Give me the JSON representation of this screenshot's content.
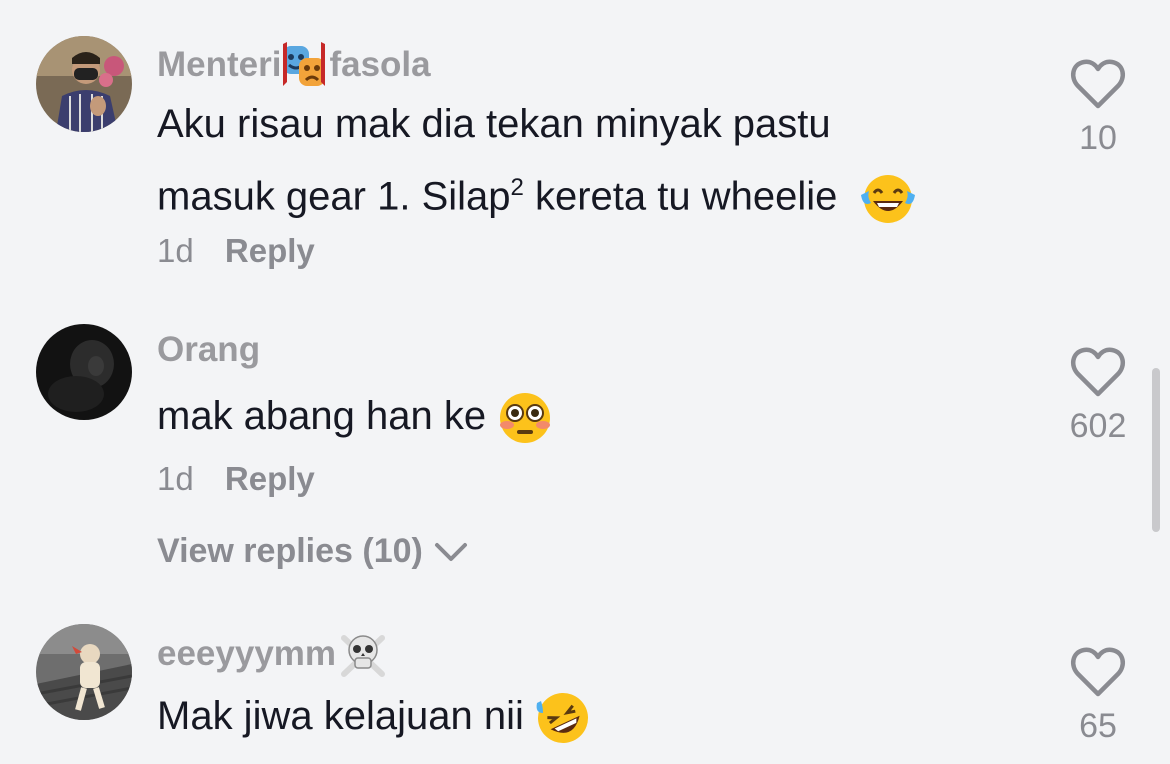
{
  "comments": [
    {
      "username_pre": "Menteri",
      "username_post": "fasola",
      "username_emoji": "performing-arts-emoji",
      "text_line1": "Aku risau mak dia tekan minyak pastu",
      "text_line2_pre": "masuk gear 1. Silap",
      "text_line2_sup": "2",
      "text_line2_post": " kereta tu wheelie",
      "text_emoji": "tears-of-joy-emoji",
      "age": "1d",
      "reply_label": "Reply",
      "likes": "10"
    },
    {
      "username": "Orang",
      "text": "mak abang han ke",
      "text_emoji": "flushed-face-emoji",
      "age": "1d",
      "reply_label": "Reply",
      "likes": "602",
      "view_replies": "View replies (10)"
    },
    {
      "username": "eeeyyymm",
      "username_emoji": "skull-crossbones-emoji",
      "text": "Mak jiwa kelajuan nii",
      "text_emoji": "rofl-emoji",
      "likes": "65"
    }
  ],
  "colors": {
    "background": "#f3f4f6",
    "primary_text": "#161823",
    "secondary_text": "#8a8b91"
  }
}
